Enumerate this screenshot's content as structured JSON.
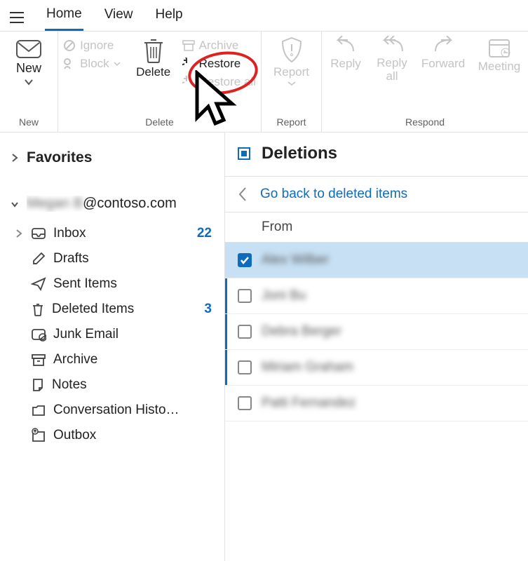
{
  "tabs": {
    "home": "Home",
    "view": "View",
    "help": "Help"
  },
  "ribbon": {
    "new": {
      "new_label": "New",
      "group": "New"
    },
    "delete": {
      "ignore": "Ignore",
      "block": "Block",
      "delete": "Delete",
      "archive": "Archive",
      "restore": "Restore",
      "restore_all": "Restore all",
      "group": "Delete"
    },
    "report": {
      "report": "Report",
      "group": "Report"
    },
    "respond": {
      "reply": "Reply",
      "reply_all": "Reply all",
      "forward": "Forward",
      "meeting": "Meeting",
      "group": "Respond"
    }
  },
  "nav": {
    "favorites": "Favorites",
    "account": "@contoso.com",
    "account_user": "Megan B",
    "folders": {
      "inbox": {
        "label": "Inbox",
        "count": "22"
      },
      "drafts": {
        "label": "Drafts"
      },
      "sent": {
        "label": "Sent Items"
      },
      "deleted": {
        "label": "Deleted Items",
        "count": "3"
      },
      "junk": {
        "label": "Junk Email"
      },
      "archive": {
        "label": "Archive"
      },
      "notes": {
        "label": "Notes"
      },
      "conv": {
        "label": "Conversation Histo…"
      },
      "outbox": {
        "label": "Outbox"
      }
    }
  },
  "list": {
    "title": "Deletions",
    "goback": "Go back to deleted items",
    "from_header": "From",
    "rows": [
      {
        "from": "Alex Wilber",
        "selected": true,
        "bar": false
      },
      {
        "from": "Joni Bu",
        "selected": false,
        "bar": true
      },
      {
        "from": "Debra Berger",
        "selected": false,
        "bar": true
      },
      {
        "from": "Miriam Graham",
        "selected": false,
        "bar": true
      },
      {
        "from": "Patti Fernandez",
        "selected": false,
        "bar": false
      }
    ]
  }
}
